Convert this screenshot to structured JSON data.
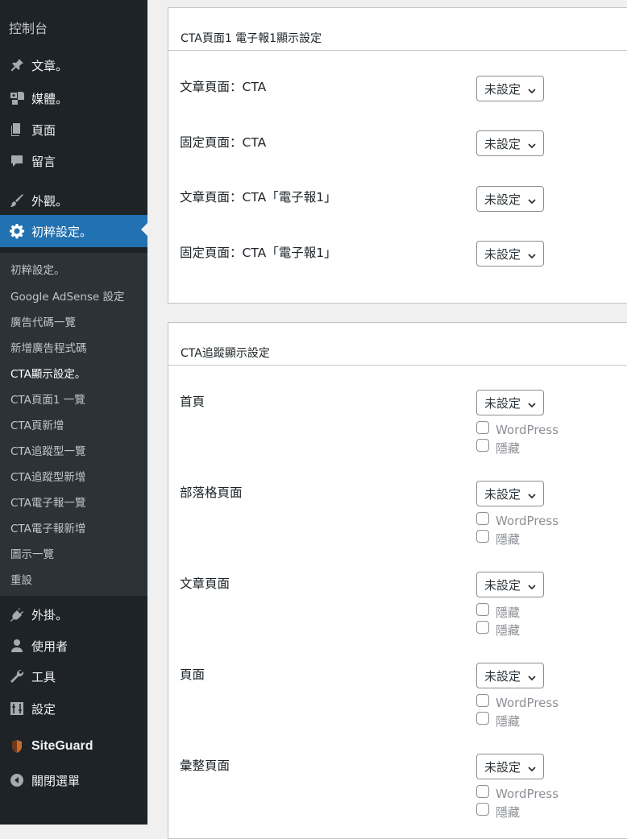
{
  "sidebar": {
    "title": "控制台",
    "menu": [
      {
        "label": "文章。",
        "icon": "pin-icon"
      },
      {
        "label": "媒體。",
        "icon": "media-icon"
      },
      {
        "label": "頁面",
        "icon": "page-icon"
      },
      {
        "label": "留言",
        "icon": "comment-icon"
      },
      {
        "label": "外觀。",
        "icon": "brush-icon"
      },
      {
        "label": "初粹設定。",
        "icon": "gear-icon"
      }
    ],
    "submenu": [
      "初粹設定。",
      "Google AdSense 設定",
      "廣告代碼一覽",
      "新增廣告程式碼",
      "CTA顯示設定。",
      "CTA頁面1 一覽",
      "CTA頁新增",
      "CTA追蹤型一覽",
      "CTA追蹤型新增",
      "CTA電子報一覽",
      "CTA電子報新增",
      "圖示一覽",
      "重設"
    ],
    "menu_bottom": [
      {
        "label": "外掛。",
        "icon": "plugin-icon"
      },
      {
        "label": "使用者",
        "icon": "user-icon"
      },
      {
        "label": "工具",
        "icon": "wrench-icon"
      },
      {
        "label": "設定",
        "icon": "settings-icon"
      },
      {
        "label": "SiteGuard",
        "icon": "siteguard-shield-icon"
      },
      {
        "label": "關閉選單",
        "icon": "collapse-arrow-icon"
      }
    ]
  },
  "panel1": {
    "title": "CTA頁面1 電子報1顯示設定",
    "rows": [
      {
        "label": "文章頁面：CTA",
        "select": "未設定"
      },
      {
        "label": "固定頁面：CTA",
        "select": "未設定"
      },
      {
        "label": "文章頁面：CTA「電子報1」",
        "select": "未設定"
      },
      {
        "label": "固定頁面：CTA「電子報1」",
        "select": "未設定"
      }
    ]
  },
  "panel2": {
    "title": "CTA追蹤顯示設定",
    "rows": [
      {
        "label": "首頁",
        "select": "未設定",
        "options": [
          "WordPress",
          "隱藏"
        ]
      },
      {
        "label": "部落格頁面",
        "select": "未設定",
        "options": [
          "WordPress",
          "隱藏"
        ]
      },
      {
        "label": "文章頁面",
        "select": "未設定",
        "options": [
          "隱藏",
          "隱藏"
        ]
      },
      {
        "label": "頁面",
        "select": "未設定",
        "options": [
          "WordPress",
          "隱藏"
        ]
      },
      {
        "label": "彙整頁面",
        "select": "未設定",
        "options": [
          "WordPress",
          "隱藏"
        ]
      }
    ]
  },
  "colors": {
    "sidebar_bg": "#1d2327",
    "submenu_bg": "#2c3338",
    "active_bg": "#2271b1",
    "page_bg": "#f0f0f1"
  }
}
